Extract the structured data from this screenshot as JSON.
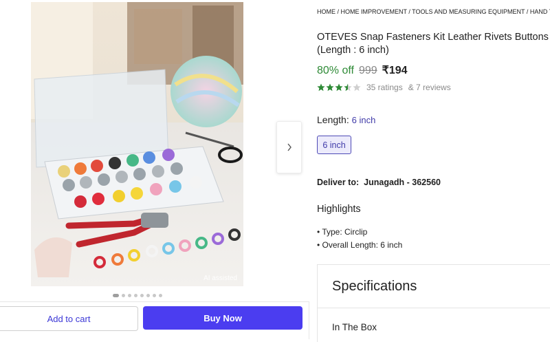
{
  "image": {
    "ai_tag": "AI assisted",
    "dot_count": 8,
    "active_dot": 0
  },
  "actions": {
    "add_to_cart": "Add to cart",
    "buy_now": "Buy Now"
  },
  "breadcrumb": "HOME / HOME IMPROVEMENT / TOOLS AND MEASURING EQUIPMENT / HAND TOO",
  "product": {
    "title_line1": "OTEVES Snap Fasteners Kit Leather Rivets Buttons P",
    "title_line2": "(Length : 6 inch)",
    "discount": "80% off",
    "mrp": "999",
    "price": "₹194",
    "rating": 3.5,
    "ratings_text": "35 ratings",
    "reviews_text": "& 7 reviews"
  },
  "length": {
    "label": "Length:",
    "value": "6 inch",
    "option": "6 inch"
  },
  "delivery": {
    "label": "Deliver to:",
    "location": "Junagadh - 362560"
  },
  "highlights": {
    "title": "Highlights",
    "items": [
      "Type: Circlip",
      "Overall Length: 6 inch"
    ]
  },
  "specifications": {
    "title": "Specifications",
    "first_section": "In The Box"
  },
  "colors": {
    "accent": "#4b3df0",
    "discount_green": "#2e8a36",
    "star_green": "#2e8a36"
  }
}
